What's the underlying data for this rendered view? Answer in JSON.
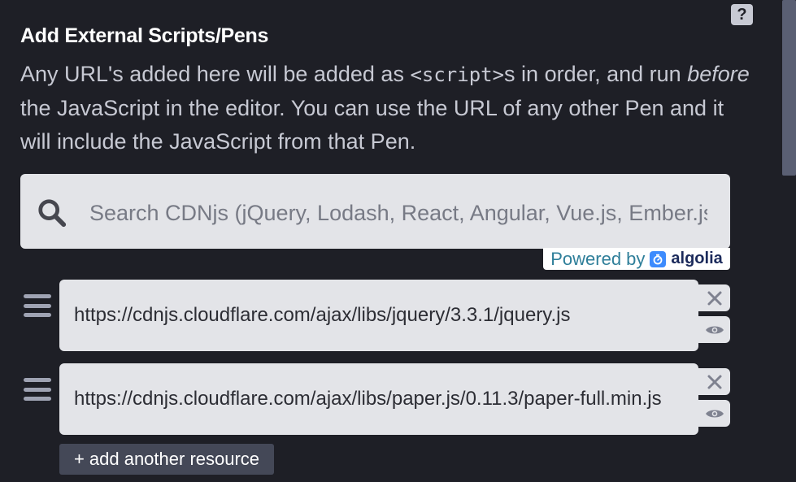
{
  "help": {
    "label": "?"
  },
  "section": {
    "title": "Add External Scripts/Pens",
    "desc_part1": "Any URL's added here will be added as ",
    "desc_code": "<script>",
    "desc_part2": "s in order, and run ",
    "desc_em": "before",
    "desc_part3": " the JavaScript in the editor. You can use the URL of any other Pen and it will include the JavaScript from that Pen."
  },
  "search": {
    "placeholder": "Search CDNjs (jQuery, Lodash, React, Angular, Vue.js, Ember.js, ...)",
    "powered_by": "Powered by",
    "algolia": "algolia"
  },
  "resources": [
    {
      "url": "https://cdnjs.cloudflare.com/ajax/libs/jquery/3.3.1/jquery.js"
    },
    {
      "url": "https://cdnjs.cloudflare.com/ajax/libs/paper.js/0.11.3/paper-full.min.js"
    }
  ],
  "add_button": {
    "label": "+ add another resource"
  },
  "colors": {
    "background": "#1e1f26",
    "field": "#e3e4e8",
    "button": "#444857",
    "accent": "#3d8bfd"
  },
  "icons": {
    "help": "question-mark-icon",
    "search": "search-icon",
    "drag": "drag-handle-icon",
    "remove": "close-icon",
    "view": "eye-icon"
  }
}
